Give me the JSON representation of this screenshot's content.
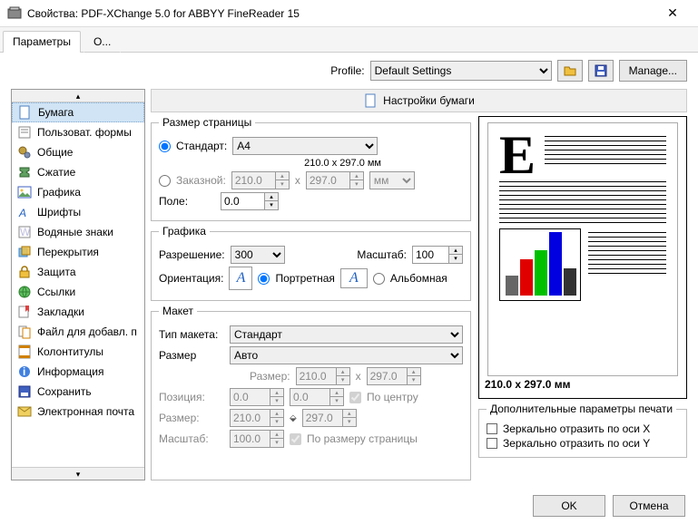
{
  "window": {
    "title": "Свойства: PDF-XChange 5.0 for ABBYY FineReader 15"
  },
  "tabs": {
    "t0": "Параметры",
    "t1": "О..."
  },
  "profile": {
    "label": "Profile:",
    "value": "Default Settings",
    "manage": "Manage..."
  },
  "sidebar": {
    "items": [
      "Бумага",
      "Пользоват. формы",
      "Общие",
      "Сжатие",
      "Графика",
      "Шрифты",
      "Водяные знаки",
      "Перекрытия",
      "Защита",
      "Ссылки",
      "Закладки",
      "Файл для добавл. п",
      "Колонтитулы",
      "Информация",
      "Сохранить",
      "Электронная почта"
    ]
  },
  "header": "Настройки бумаги",
  "pageSize": {
    "legend": "Размер страницы",
    "standard": "Стандарт:",
    "standardVal": "A4",
    "dimsNote": "210.0 x 297.0 мм",
    "custom": "Заказной:",
    "cw": "210.0",
    "ch": "297.0",
    "unit": "мм",
    "margin": "Поле:",
    "marginVal": "0.0"
  },
  "graphic": {
    "legend": "Графика",
    "resolution": "Разрешение:",
    "resVal": "300",
    "scale": "Масштаб:",
    "scaleVal": "100",
    "orientation": "Ориентация:",
    "portrait": "Портретная",
    "landscape": "Альбомная"
  },
  "layout": {
    "legend": "Макет",
    "type": "Тип макета:",
    "typeVal": "Стандарт",
    "size": "Размер",
    "sizeVal": "Авто",
    "sizeLabel": "Размер:",
    "sw": "210.0",
    "sh": "297.0",
    "position": "Позиция:",
    "px": "0.0",
    "py": "0.0",
    "center": "По центру",
    "size2": "Размер:",
    "s2w": "210.0",
    "s2h": "297.0",
    "scale2": "Масштаб:",
    "scale2Val": "100.0",
    "fit": "По размеру страницы"
  },
  "preview": {
    "dims": "210.0 x 297.0 мм"
  },
  "extra": {
    "legend": "Дополнительные параметры печати",
    "mirrorX": "Зеркально отразить по оси X",
    "mirrorY": "Зеркально отразить по оси Y"
  },
  "footer": {
    "ok": "OK",
    "cancel": "Отмена"
  }
}
